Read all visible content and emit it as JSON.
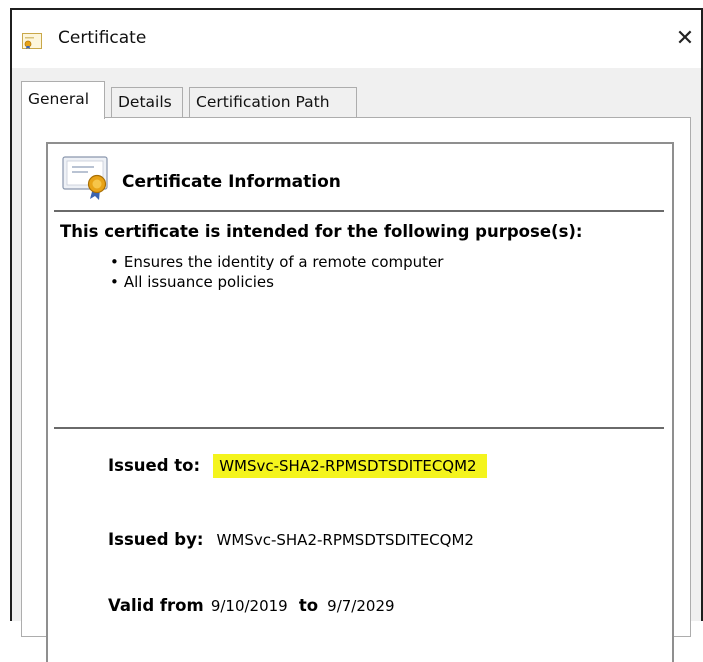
{
  "window": {
    "title": "Certificate",
    "close_glyph": "✕"
  },
  "tabs": [
    {
      "label": "General",
      "active": true
    },
    {
      "label": "Details",
      "active": false
    },
    {
      "label": "Certification Path",
      "active": false
    }
  ],
  "general": {
    "heading": "Certificate Information",
    "purpose_heading": "This certificate is intended for the following purpose(s):",
    "purposes": [
      "Ensures the identity of a remote computer",
      "All issuance policies"
    ],
    "issued_to_label": "Issued to:",
    "issued_to_value": "WMSvc-SHA2-RPMSDTSDITECQM2",
    "issued_by_label": "Issued by:",
    "issued_by_value": "WMSvc-SHA2-RPMSDTSDITECQM2",
    "valid_from_label": "Valid from",
    "valid_from_value": "9/10/2019",
    "to_label": "to",
    "valid_to_value": "9/7/2029"
  },
  "colors": {
    "highlight": "#f4f41d",
    "seal": "#e8a317"
  },
  "icons": {
    "title": "certificate-icon",
    "info": "certificate-seal-icon",
    "close": "close-icon"
  }
}
